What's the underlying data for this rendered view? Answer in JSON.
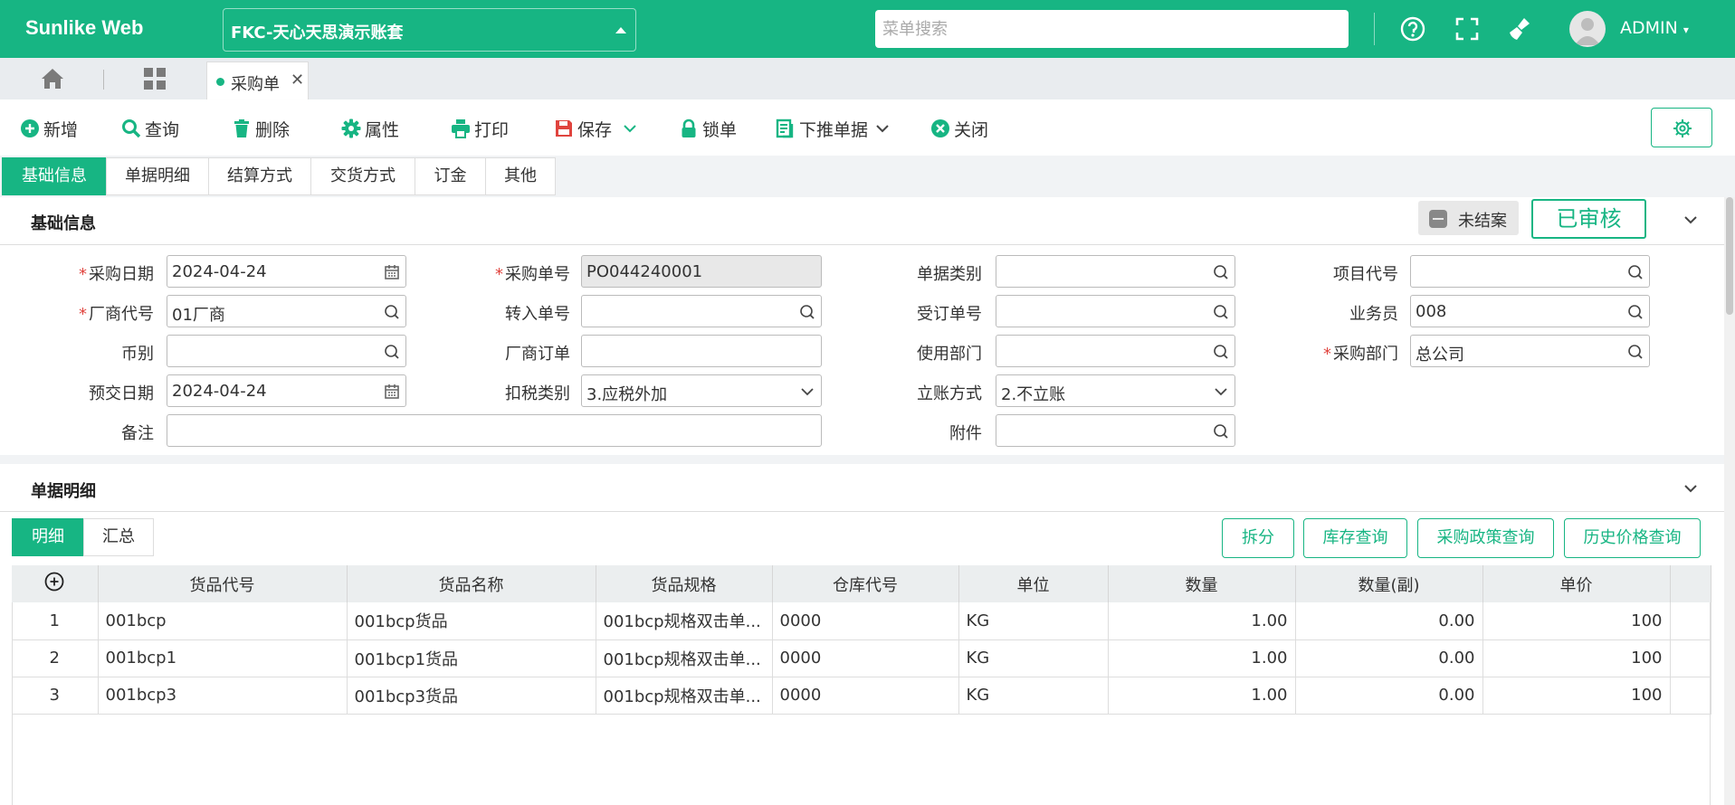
{
  "app": {
    "brand": "Sunlike Web",
    "account": "FKC-天心天思演示账套",
    "search_placeholder": "菜单搜索",
    "user": "ADMIN"
  },
  "colors": {
    "primary": "#17b583",
    "required": "#e0443e"
  },
  "tabs": {
    "doc_tab": "采购单"
  },
  "toolbar": {
    "add": "新增",
    "query": "查询",
    "delete": "删除",
    "props": "属性",
    "print": "打印",
    "save": "保存",
    "lock": "锁单",
    "push": "下推单据",
    "close": "关闭"
  },
  "section_tabs": [
    "基础信息",
    "单据明细",
    "结算方式",
    "交货方式",
    "订金",
    "其他"
  ],
  "basic": {
    "title": "基础信息",
    "status_open": "未结案",
    "status_approved": "已审核",
    "labels": {
      "purchase_date": "采购日期",
      "vendor_code": "厂商代号",
      "currency": "币别",
      "delivery_date": "预交日期",
      "remark": "备注",
      "purchase_no": "采购单号",
      "transfer_no": "转入单号",
      "vendor_order": "厂商订单",
      "tax_type": "扣税类别",
      "doc_type": "单据类别",
      "order_no": "受订单号",
      "use_dept": "使用部门",
      "account_mode": "立账方式",
      "attachment": "附件",
      "project_code": "项目代号",
      "salesman": "业务员",
      "purchase_dept": "采购部门"
    },
    "values": {
      "purchase_date": "2024-04-24",
      "vendor_code": "01厂商",
      "currency": "",
      "delivery_date": "2024-04-24",
      "remark": "",
      "purchase_no": "PO044240001",
      "transfer_no": "",
      "vendor_order": "",
      "tax_type": "3.应税外加",
      "doc_type": "",
      "order_no": "",
      "use_dept": "",
      "account_mode": "2.不立账",
      "attachment": "",
      "project_code": "",
      "salesman": "008",
      "purchase_dept": "总公司"
    }
  },
  "detail": {
    "title": "单据明细",
    "subtabs": [
      "明细",
      "汇总"
    ],
    "buttons": [
      "拆分",
      "库存查询",
      "采购政策查询",
      "历史价格查询"
    ],
    "columns": [
      "货品代号",
      "货品名称",
      "货品规格",
      "仓库代号",
      "单位",
      "数量",
      "数量(副)",
      "单价"
    ],
    "rows": [
      {
        "no": "1",
        "code": "001bcp",
        "name": "001bcp货品",
        "spec": "001bcp规格双击单...",
        "wh": "0000",
        "unit": "KG",
        "qty": "1.00",
        "qty2": "0.00",
        "price": "100"
      },
      {
        "no": "2",
        "code": "001bcp1",
        "name": "001bcp1货品",
        "spec": "001bcp规格双击单...",
        "wh": "0000",
        "unit": "KG",
        "qty": "1.00",
        "qty2": "0.00",
        "price": "100"
      },
      {
        "no": "3",
        "code": "001bcp3",
        "name": "001bcp3货品",
        "spec": "001bcp规格双击单...",
        "wh": "0000",
        "unit": "KG",
        "qty": "1.00",
        "qty2": "0.00",
        "price": "100"
      }
    ]
  }
}
